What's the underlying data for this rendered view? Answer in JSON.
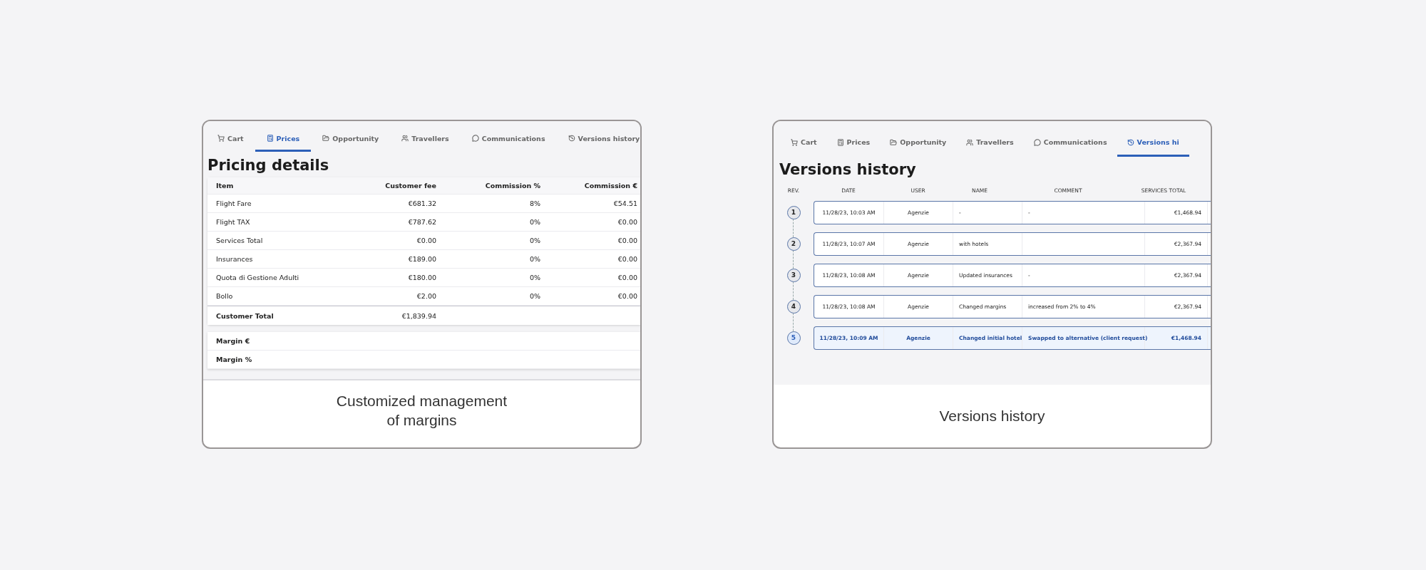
{
  "cards": [
    {
      "kind": "pricing",
      "tabs": [
        {
          "label": "Cart",
          "selected": false
        },
        {
          "label": "Prices",
          "selected": true
        },
        {
          "label": "Opportunity",
          "selected": false
        },
        {
          "label": "Travellers",
          "selected": false
        },
        {
          "label": "Communications",
          "selected": false
        },
        {
          "label": "Versions history",
          "selected": false
        }
      ],
      "title": "Pricing details",
      "table": {
        "columns": [
          "Item",
          "Customer fee",
          "Commission %",
          "Commission €"
        ],
        "rows": [
          [
            "Flight Fare",
            "€681.32",
            "8%",
            "€54.51"
          ],
          [
            "Flight TAX",
            "€787.62",
            "0%",
            "€0.00"
          ],
          [
            "Services Total",
            "€0.00",
            "0%",
            "€0.00"
          ],
          [
            "Insurances",
            "€189.00",
            "0%",
            "€0.00"
          ],
          [
            "Quota di Gestione Adulti",
            "€180.00",
            "0%",
            "€0.00"
          ],
          [
            "Bollo",
            "€2.00",
            "0%",
            "€0.00"
          ]
        ],
        "total": [
          "Customer Total",
          "€1,839.94"
        ]
      },
      "margins": [
        "Margin €",
        "Margin %"
      ],
      "caption": "Customized management of margins"
    },
    {
      "kind": "versions",
      "tabs": [
        {
          "label": "Cart",
          "selected": false
        },
        {
          "label": "Prices",
          "selected": false
        },
        {
          "label": "Opportunity",
          "selected": false
        },
        {
          "label": "Travellers",
          "selected": false
        },
        {
          "label": "Communications",
          "selected": false
        },
        {
          "label": "Versions hi",
          "selected": true
        }
      ],
      "title": "Versions history",
      "columns": [
        "REV.",
        "DATE",
        "USER",
        "NAME",
        "COMMENT",
        "SERVICES TOTAL"
      ],
      "rows": [
        {
          "rev": "1",
          "date": "11/28/23, 10:03 AM",
          "user": "Agenzie",
          "name": "-",
          "comment": "-",
          "services_total": "€1,468.94",
          "selected": false
        },
        {
          "rev": "2",
          "date": "11/28/23, 10:07 AM",
          "user": "Agenzie",
          "name": "with hotels",
          "services_total": "€2,367.94",
          "selected": false
        },
        {
          "rev": "3",
          "date": "11/28/23, 10:08 AM",
          "user": "Agenzie",
          "name": "Updated insurances",
          "comment": "-",
          "services_total": "€2,367.94",
          "selected": false
        },
        {
          "rev": "4",
          "date": "11/28/23, 10:08 AM",
          "user": "Agenzie",
          "name": "Changed margins",
          "comment": "increased from 2% to 4%",
          "services_total": "€2,367.94",
          "selected": false
        },
        {
          "rev": "5",
          "date": "11/28/23, 10:09 AM",
          "user": "Agenzie",
          "name": "Changed initial hotel",
          "comment": "Swapped to alternative (client request)",
          "services_total": "€1,468.94",
          "selected": true
        }
      ],
      "caption": "Versions history"
    }
  ]
}
